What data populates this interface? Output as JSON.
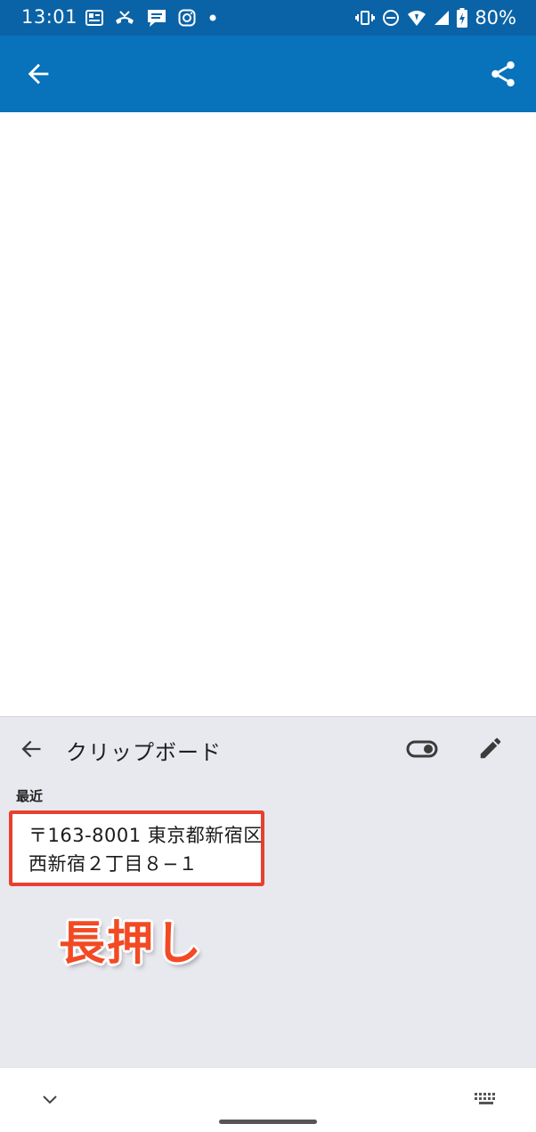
{
  "status_bar": {
    "time": "13:01",
    "left_icons": [
      "news-icon",
      "missed-call-icon",
      "line-manga-icon",
      "instagram-icon",
      "dot-icon"
    ],
    "right_icons": [
      "vibrate-icon",
      "do-not-disturb-icon",
      "wifi-icon",
      "signal-icon",
      "battery-charging-icon"
    ],
    "battery": "80%"
  },
  "app_bar": {
    "color": "#0872bb",
    "back_icon": "arrow-back-icon",
    "share_icon": "share-icon"
  },
  "clipboard": {
    "title": "クリップボード",
    "back_icon": "arrow-back-icon",
    "toggle_icon": "toggle-icon",
    "edit_icon": "pencil-icon",
    "section_label": "最近",
    "items": [
      {
        "line1": "〒163-8001 東京都新宿区",
        "line2": "西新宿２丁目８−１"
      }
    ],
    "highlight_color": "#e8402e"
  },
  "annotation": {
    "text": "長押し",
    "color": "#f24a24"
  },
  "nav_bar": {
    "down_icon": "chevron-down-icon",
    "keyboard_icon": "keyboard-icon"
  }
}
